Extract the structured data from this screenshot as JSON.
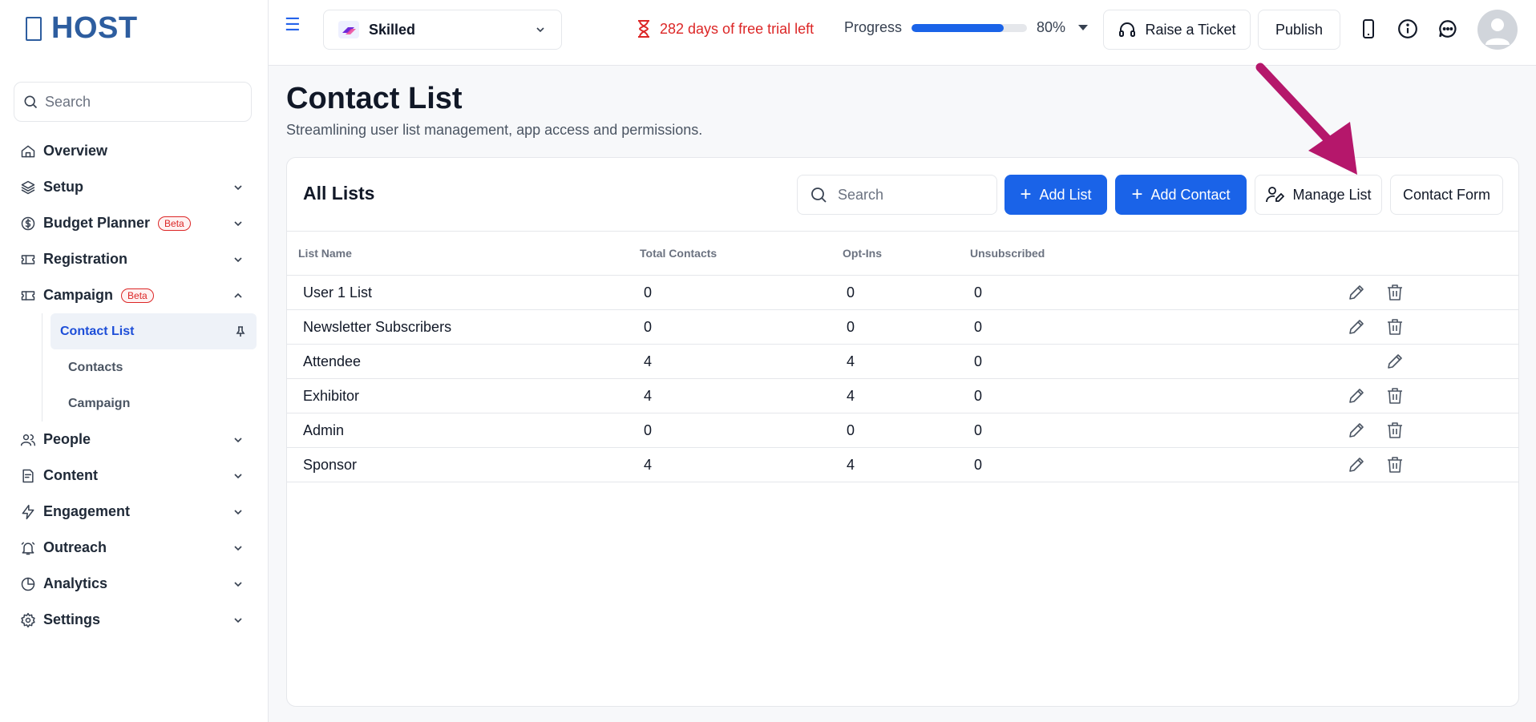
{
  "brand": {
    "name": "HOST"
  },
  "sidebar": {
    "search_placeholder": "Search",
    "items": [
      {
        "label": "Overview",
        "icon": "home-icon",
        "chevron": false,
        "beta": ""
      },
      {
        "label": "Setup",
        "icon": "layers-icon",
        "chevron": true,
        "beta": ""
      },
      {
        "label": "Budget Planner",
        "icon": "dollar-icon",
        "chevron": true,
        "beta": "Beta"
      },
      {
        "label": "Registration",
        "icon": "ticket-icon",
        "chevron": true,
        "beta": ""
      },
      {
        "label": "Campaign",
        "icon": "ticket-icon",
        "chevron": true,
        "beta": "Beta",
        "expanded": true
      },
      {
        "label": "People",
        "icon": "users-icon",
        "chevron": true,
        "beta": ""
      },
      {
        "label": "Content",
        "icon": "document-icon",
        "chevron": true,
        "beta": ""
      },
      {
        "label": "Engagement",
        "icon": "bolt-icon",
        "chevron": true,
        "beta": ""
      },
      {
        "label": "Outreach",
        "icon": "bell-icon",
        "chevron": true,
        "beta": ""
      },
      {
        "label": "Analytics",
        "icon": "pie-chart-icon",
        "chevron": true,
        "beta": ""
      },
      {
        "label": "Settings",
        "icon": "gear-icon",
        "chevron": true,
        "beta": ""
      }
    ],
    "campaign_sub": [
      {
        "label": "Contact List",
        "active": true
      },
      {
        "label": "Contacts",
        "active": false
      },
      {
        "label": "Campaign",
        "active": false
      }
    ]
  },
  "topbar": {
    "event_name": "Skilled",
    "trial_text": "282 days of free trial left",
    "progress_label": "Progress",
    "progress_value": 0.8,
    "progress_text": "80%",
    "raise_ticket": "Raise a Ticket",
    "publish": "Publish"
  },
  "page": {
    "title": "Contact List",
    "subtitle": "Streamlining user list management, app access and permissions."
  },
  "card": {
    "title": "All Lists",
    "search_placeholder": "Search",
    "add_list": "Add List",
    "add_contact": "Add Contact",
    "manage_list": "Manage List",
    "contact_form": "Contact Form"
  },
  "table": {
    "headers": [
      "List Name",
      "Total Contacts",
      "Opt-Ins",
      "Unsubscribed"
    ],
    "rows": [
      {
        "name": "User 1 List",
        "total": "0",
        "optins": "0",
        "unsub": "0",
        "delete": true
      },
      {
        "name": "Newsletter Subscribers",
        "total": "0",
        "optins": "0",
        "unsub": "0",
        "delete": true
      },
      {
        "name": "Attendee",
        "total": "4",
        "optins": "4",
        "unsub": "0",
        "delete": false
      },
      {
        "name": "Exhibitor",
        "total": "4",
        "optins": "4",
        "unsub": "0",
        "delete": true
      },
      {
        "name": "Admin",
        "total": "0",
        "optins": "0",
        "unsub": "0",
        "delete": true
      },
      {
        "name": "Sponsor",
        "total": "4",
        "optins": "4",
        "unsub": "0",
        "delete": true
      }
    ]
  },
  "colors": {
    "primary": "#1a63e8",
    "brand": "#2d5d9f",
    "alert": "#dc2626",
    "annotation": "#b5176b"
  }
}
